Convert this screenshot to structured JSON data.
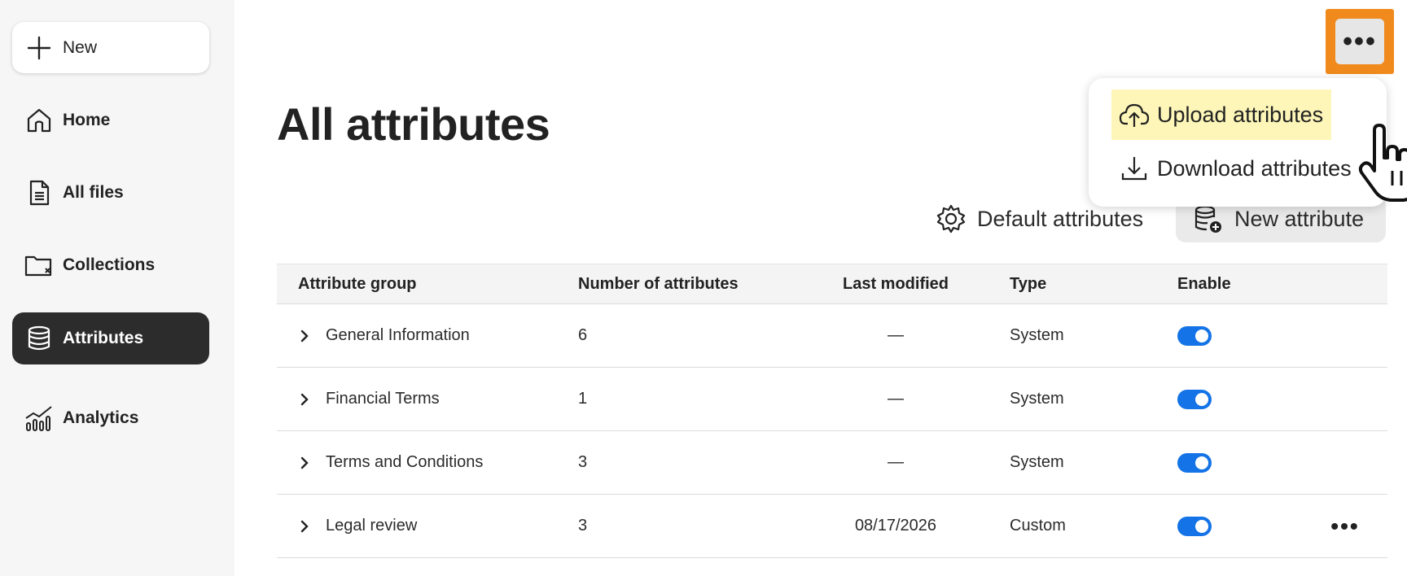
{
  "sidebar": {
    "new_label": "New",
    "items": [
      {
        "label": "Home",
        "icon": "home-icon"
      },
      {
        "label": "All files",
        "icon": "file-icon"
      },
      {
        "label": "Collections",
        "icon": "folder-icon"
      },
      {
        "label": "Attributes",
        "icon": "database-icon",
        "active": true
      },
      {
        "label": "Analytics",
        "icon": "analytics-icon"
      }
    ]
  },
  "main": {
    "title": "All attributes",
    "more_label": "•••",
    "toolbar": {
      "default_attributes": "Default attributes",
      "new_attribute": "New attribute"
    },
    "menu": {
      "upload": "Upload attributes",
      "download": "Download attributes"
    },
    "table": {
      "headers": [
        "Attribute group",
        "Number of attributes",
        "Last modified",
        "Type",
        "Enable"
      ],
      "rows": [
        {
          "group": "General Information",
          "count": "6",
          "modified": "—",
          "type": "System",
          "enabled": true
        },
        {
          "group": "Financial Terms",
          "count": "1",
          "modified": "—",
          "type": "System",
          "enabled": true
        },
        {
          "group": "Terms and Conditions",
          "count": "3",
          "modified": "—",
          "type": "System",
          "enabled": true
        },
        {
          "group": "Legal review",
          "count": "3",
          "modified": "08/17/2026",
          "type": "Custom",
          "enabled": true,
          "has_more": true
        }
      ],
      "row_more_label": "•••"
    }
  },
  "colors": {
    "accent": "#1473e6",
    "highlight_orange": "#f08a1c",
    "menu_highlight": "#fdf6b8",
    "sidebar_active": "#2c2c2c"
  }
}
